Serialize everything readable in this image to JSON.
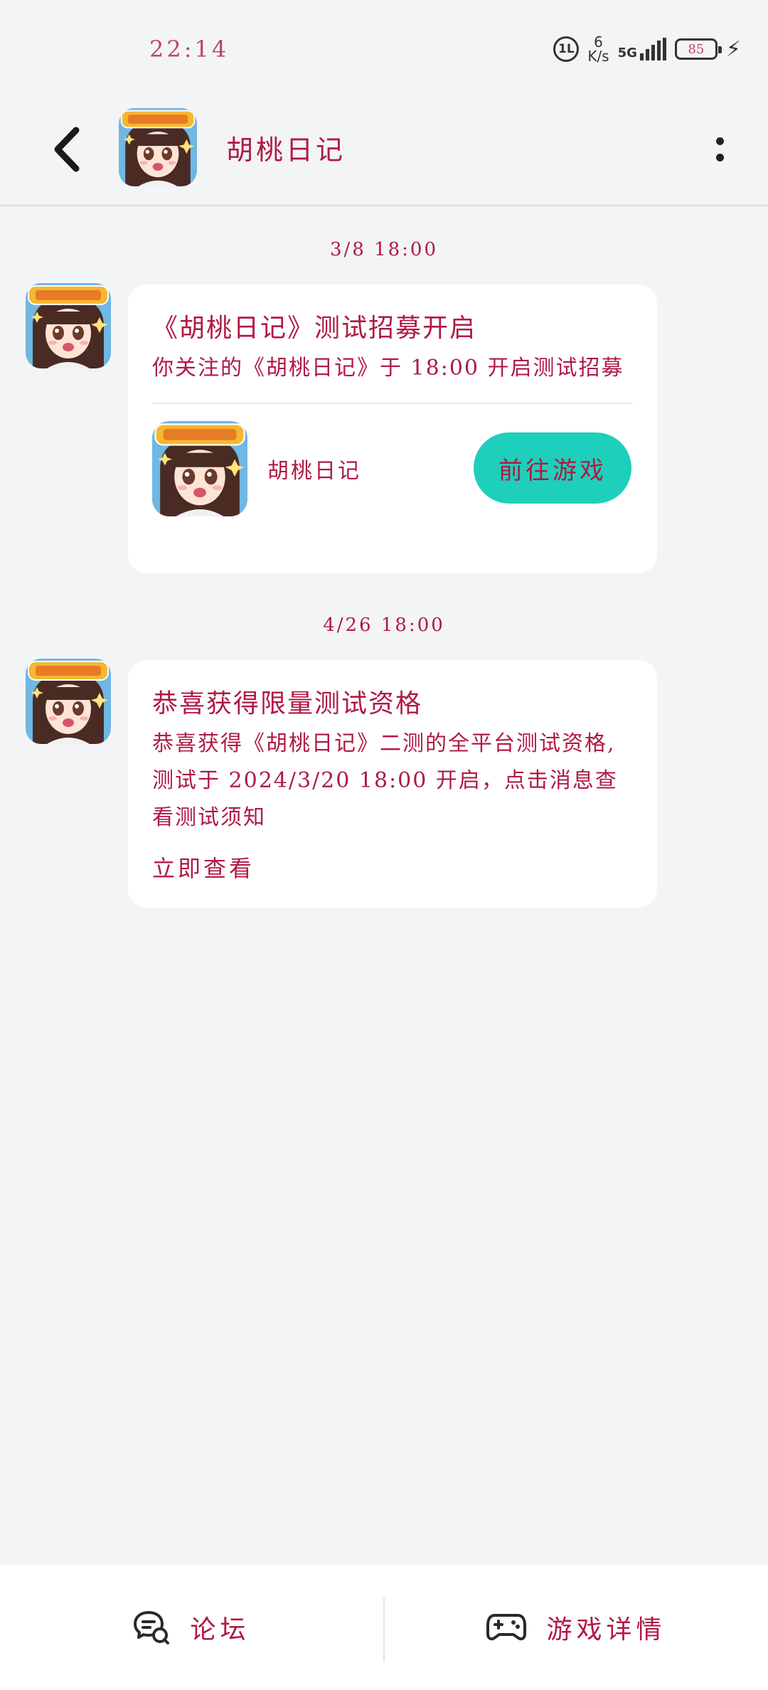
{
  "status_bar": {
    "time": "22:14",
    "hd_label": "1L",
    "speed_value": "6",
    "speed_unit": "K/s",
    "network": "5G",
    "battery": "85"
  },
  "header": {
    "title": "胡桃日记"
  },
  "messages": [
    {
      "timestamp": "3/8 18:00",
      "title": "《胡桃日记》测试招募开启",
      "body": "你关注的《胡桃日记》于 18:00 开启测试招募",
      "game_name": "胡桃日记",
      "button_label": "前往游戏"
    },
    {
      "timestamp": "4/26 18:00",
      "title": "恭喜获得限量测试资格",
      "body": "恭喜获得《胡桃日记》二测的全平台测试资格,测试于 2024/3/20 18:00 开启，点击消息查看测试须知",
      "link_label": "立即查看"
    }
  ],
  "bottom_nav": {
    "forum_label": "论坛",
    "details_label": "游戏详情"
  },
  "colors": {
    "accent": "#1ecfbc",
    "text": "#b01a43",
    "background": "#f3f4f6"
  }
}
